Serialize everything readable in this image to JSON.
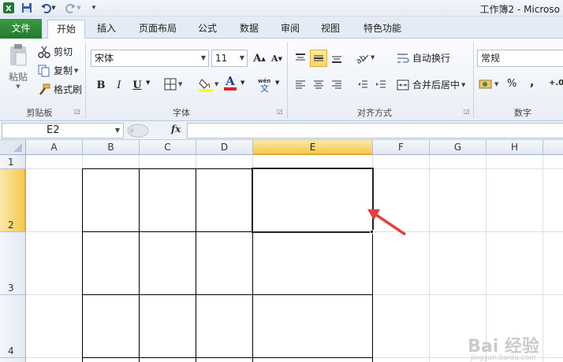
{
  "title_bar": {
    "title": "工作簿2  -  Microso",
    "quick_access": [
      "save-icon",
      "undo-icon",
      "redo-icon",
      "customize-icon"
    ]
  },
  "tabs": [
    {
      "label": "文件"
    },
    {
      "label": "开始"
    },
    {
      "label": "插入"
    },
    {
      "label": "页面布局"
    },
    {
      "label": "公式"
    },
    {
      "label": "数据"
    },
    {
      "label": "审阅"
    },
    {
      "label": "视图"
    },
    {
      "label": "特色功能"
    }
  ],
  "active_tab": "开始",
  "ribbon": {
    "clipboard": {
      "label": "剪贴板",
      "paste": "粘贴",
      "cut": "剪切",
      "copy": "复制",
      "format_painter": "格式刷"
    },
    "font": {
      "label": "字体",
      "font_name": "宋体",
      "font_size": "11",
      "bold": "B",
      "italic": "I",
      "underline": "U",
      "grow": "A",
      "shrink": "A",
      "font_color_letter": "A",
      "font_color": "#e02020",
      "fill_color": "#ffff00"
    },
    "alignment": {
      "label": "对齐方式",
      "wrap_text": "自动换行",
      "merge_center": "合并后居中"
    },
    "number": {
      "label": "数字",
      "format": "常规",
      "percent": "%",
      "comma": ",",
      "increase_decimal": "+.0"
    }
  },
  "formula_bar": {
    "name_box": "E2",
    "fx": "fx",
    "formula": ""
  },
  "grid": {
    "columns": [
      "A",
      "B",
      "C",
      "D",
      "E",
      "F",
      "G",
      "H"
    ],
    "rows": [
      "1",
      "2",
      "3",
      "4"
    ],
    "selected_cell": "E2",
    "selected_column": "E",
    "selected_row": "2",
    "header_highlight": "#f6c94f"
  },
  "annotation": {
    "arrow_color": "#e83e3e",
    "arrow_icon": "red-arrow-icon"
  },
  "watermark": {
    "text": "Bai 经验",
    "sub": "jingyan.baidu.com"
  }
}
